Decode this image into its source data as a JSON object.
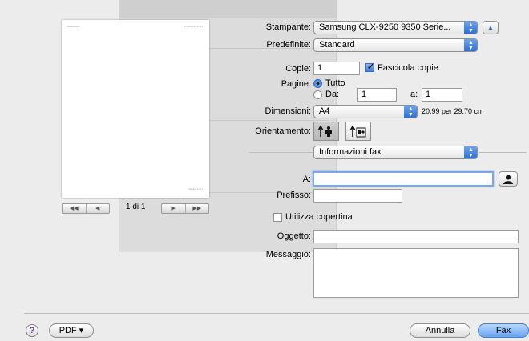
{
  "preview": {
    "header_left": "Senza titolo",
    "header_right": "27/05/2013 17:21",
    "footer_right": "Pagina 1 di 1",
    "page_info": "1 di 1",
    "nav_first": "◀◀",
    "nav_prev": "◀",
    "nav_next": "▶",
    "nav_last": "▶▶"
  },
  "printer": {
    "label": "Stampante:",
    "value": "Samsung CLX-9250 9350 Serie...",
    "arrow_up": "▲",
    "arrow_down": "▼",
    "collapse_glyph": "▲"
  },
  "presets": {
    "label": "Predefinite:",
    "value": "Standard"
  },
  "copies": {
    "label": "Copie:",
    "value": "1",
    "collate_label": "Fascicola copie",
    "collate_checked": true
  },
  "pages": {
    "label": "Pagine:",
    "all_label": "Tutto",
    "from_label": "Da:",
    "from_value": "1",
    "to_label": "a:",
    "to_value": "1",
    "selected": "all"
  },
  "paper": {
    "label": "Dimensioni:",
    "value": "A4",
    "size_text": "20.99 per 29.70 cm"
  },
  "orientation": {
    "label": "Orientamento:",
    "selected": "portrait"
  },
  "section": {
    "value": "Informazioni fax"
  },
  "fax": {
    "to_label": "A:",
    "to_value": "",
    "prefix_label": "Prefisso:",
    "prefix_value": "",
    "cover_label": "Utilizza copertina",
    "cover_checked": false,
    "subject_label": "Oggetto:",
    "subject_value": "",
    "message_label": "Messaggio:",
    "message_value": ""
  },
  "footer": {
    "help": "?",
    "pdf": "PDF ▾",
    "cancel": "Annulla",
    "fax": "Fax"
  },
  "colors": {
    "accent": "#2a6bd6",
    "focus": "#7aa7e9",
    "background": "#ececec"
  }
}
